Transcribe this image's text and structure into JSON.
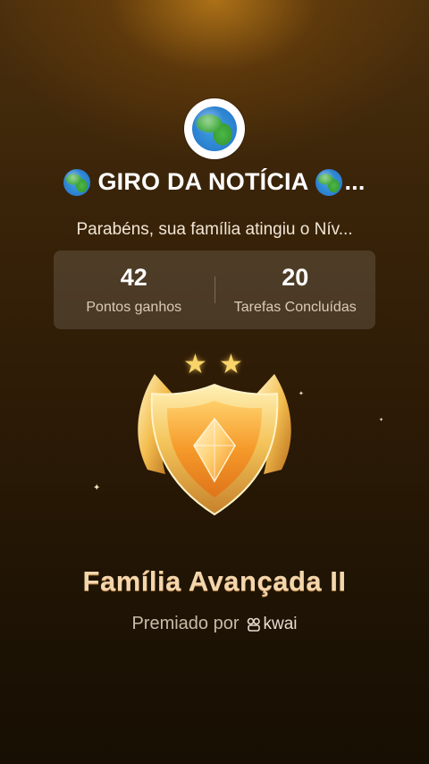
{
  "header": {
    "title": "GIRO DA NOTÍCIA",
    "title_suffix": "...",
    "subtitle": "Parabéns, sua família atingiu o Nív..."
  },
  "stats": [
    {
      "value": "42",
      "label": "Pontos ganhos"
    },
    {
      "value": "20",
      "label": "Tarefas Concluídas"
    }
  ],
  "award": {
    "stars": 2,
    "name": "Família Avançada II",
    "awarded_by_label": "Premiado por",
    "brand": "kwai"
  },
  "icons": {
    "avatar": "globe-icon",
    "title_prefix": "globe-icon",
    "title_suffix": "globe-icon",
    "badge": "shield-badge-icon",
    "brand": "kwai-logo-icon"
  },
  "colors": {
    "award_text": "#f4d6ad",
    "star": "#f9d46a"
  }
}
